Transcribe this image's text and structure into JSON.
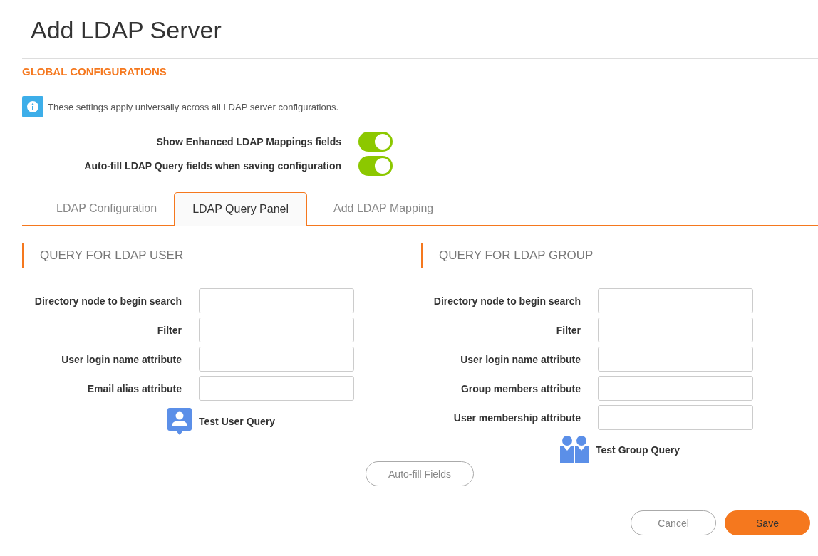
{
  "title": "Add LDAP Server",
  "section_heading": "GLOBAL CONFIGURATIONS",
  "info_text": "These settings apply universally across all LDAP server configurations.",
  "toggles": [
    {
      "label": "Show Enhanced LDAP Mappings fields",
      "on": true
    },
    {
      "label": "Auto-fill LDAP Query fields when saving configuration",
      "on": true
    }
  ],
  "tabs": [
    {
      "label": "LDAP Configuration",
      "selected": false
    },
    {
      "label": "LDAP Query Panel",
      "selected": true
    },
    {
      "label": "Add LDAP Mapping",
      "selected": false
    }
  ],
  "panels": [
    {
      "kind": "user",
      "heading": "QUERY FOR LDAP USER",
      "fields": [
        {
          "label": "Directory node to begin search"
        },
        {
          "label": "Filter"
        },
        {
          "label": "User login name attribute"
        },
        {
          "label": "Email alias attribute"
        }
      ],
      "test_link": "Test User Query"
    },
    {
      "kind": "group",
      "heading": "QUERY FOR LDAP GROUP",
      "fields": [
        {
          "label": "Directory node to begin search"
        },
        {
          "label": "Filter"
        },
        {
          "label": "User login name attribute"
        },
        {
          "label": "Group members attribute"
        },
        {
          "label": "User membership attribute"
        }
      ],
      "test_link": "Test Group Query"
    }
  ],
  "autofill_button": "Auto-fill Fields",
  "buttons": {
    "cancel": "Cancel",
    "save": "Save"
  }
}
